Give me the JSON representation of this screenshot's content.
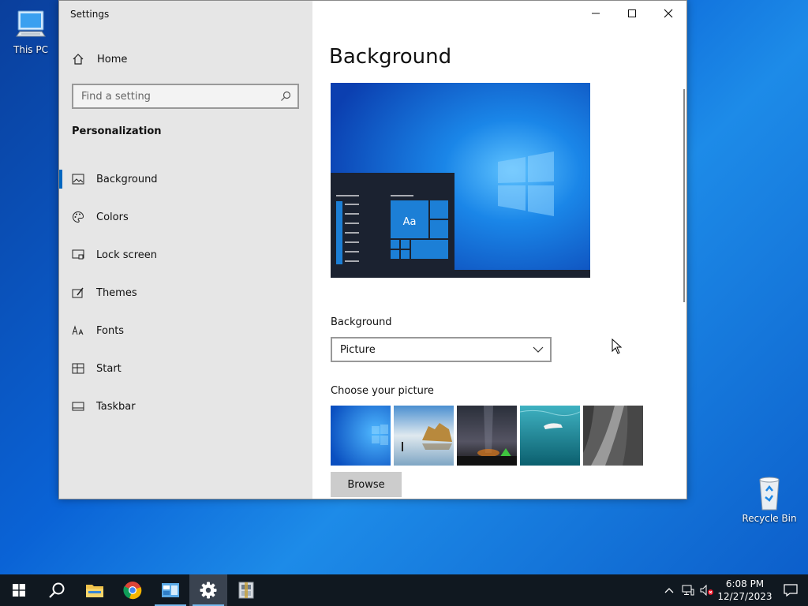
{
  "desktop": {
    "icons": [
      {
        "label": "This PC"
      },
      {
        "label": "Recycle Bin"
      }
    ]
  },
  "window": {
    "title": "Settings",
    "controls": {
      "minimize": "minimize-icon",
      "maximize": "maximize-icon",
      "close": "close-icon"
    }
  },
  "sidebar": {
    "home_label": "Home",
    "search_placeholder": "Find a setting",
    "section_title": "Personalization",
    "items": [
      {
        "label": "Background",
        "icon": "picture-icon",
        "active": true
      },
      {
        "label": "Colors",
        "icon": "palette-icon"
      },
      {
        "label": "Lock screen",
        "icon": "lock-screen-icon"
      },
      {
        "label": "Themes",
        "icon": "themes-icon"
      },
      {
        "label": "Fonts",
        "icon": "fonts-icon"
      },
      {
        "label": "Start",
        "icon": "start-icon"
      },
      {
        "label": "Taskbar",
        "icon": "taskbar-icon"
      }
    ]
  },
  "main": {
    "page_title": "Background",
    "preview_sample_text": "Aa",
    "background_label": "Background",
    "background_value": "Picture",
    "choose_label": "Choose your picture",
    "thumbnails": [
      "windows-blue",
      "beach-rocks",
      "night-sky",
      "underwater-swimmer",
      "rock-cliff"
    ],
    "browse_label": "Browse"
  },
  "taskbar": {
    "apps": [
      "start-button",
      "search",
      "file-explorer",
      "chrome",
      "control-panel",
      "settings",
      "archive"
    ],
    "active_app": "settings",
    "clock_time": "6:08 PM",
    "clock_date": "12/27/2023"
  },
  "colors": {
    "accent": "#0067c0",
    "sidebar_bg": "#e6e6e6",
    "taskbar_bg": "#101820"
  }
}
